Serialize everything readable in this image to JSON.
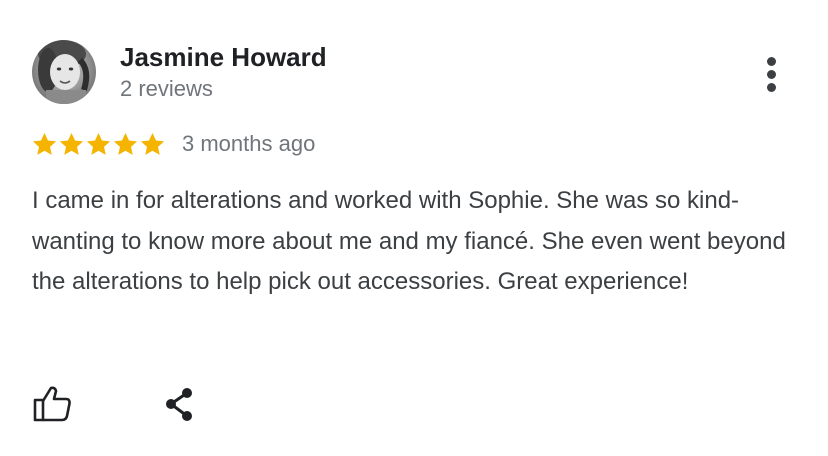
{
  "review": {
    "author": {
      "name": "Jasmine Howard",
      "review_count": "2 reviews",
      "avatar_icon": "user-photo-avatar"
    },
    "rating": {
      "stars": 5,
      "max_stars": 5,
      "star_color": "#f4b400"
    },
    "time_ago": "3 months ago",
    "text": "I came in for alterations and worked with Sophie. She was so kind- wanting to know more about me and my fiancé. She even went beyond the alterations to help pick out accessories. Great experience!",
    "actions": {
      "like_icon": "thumbs-up-icon",
      "share_icon": "share-icon",
      "more_icon": "more-vert-icon"
    }
  }
}
